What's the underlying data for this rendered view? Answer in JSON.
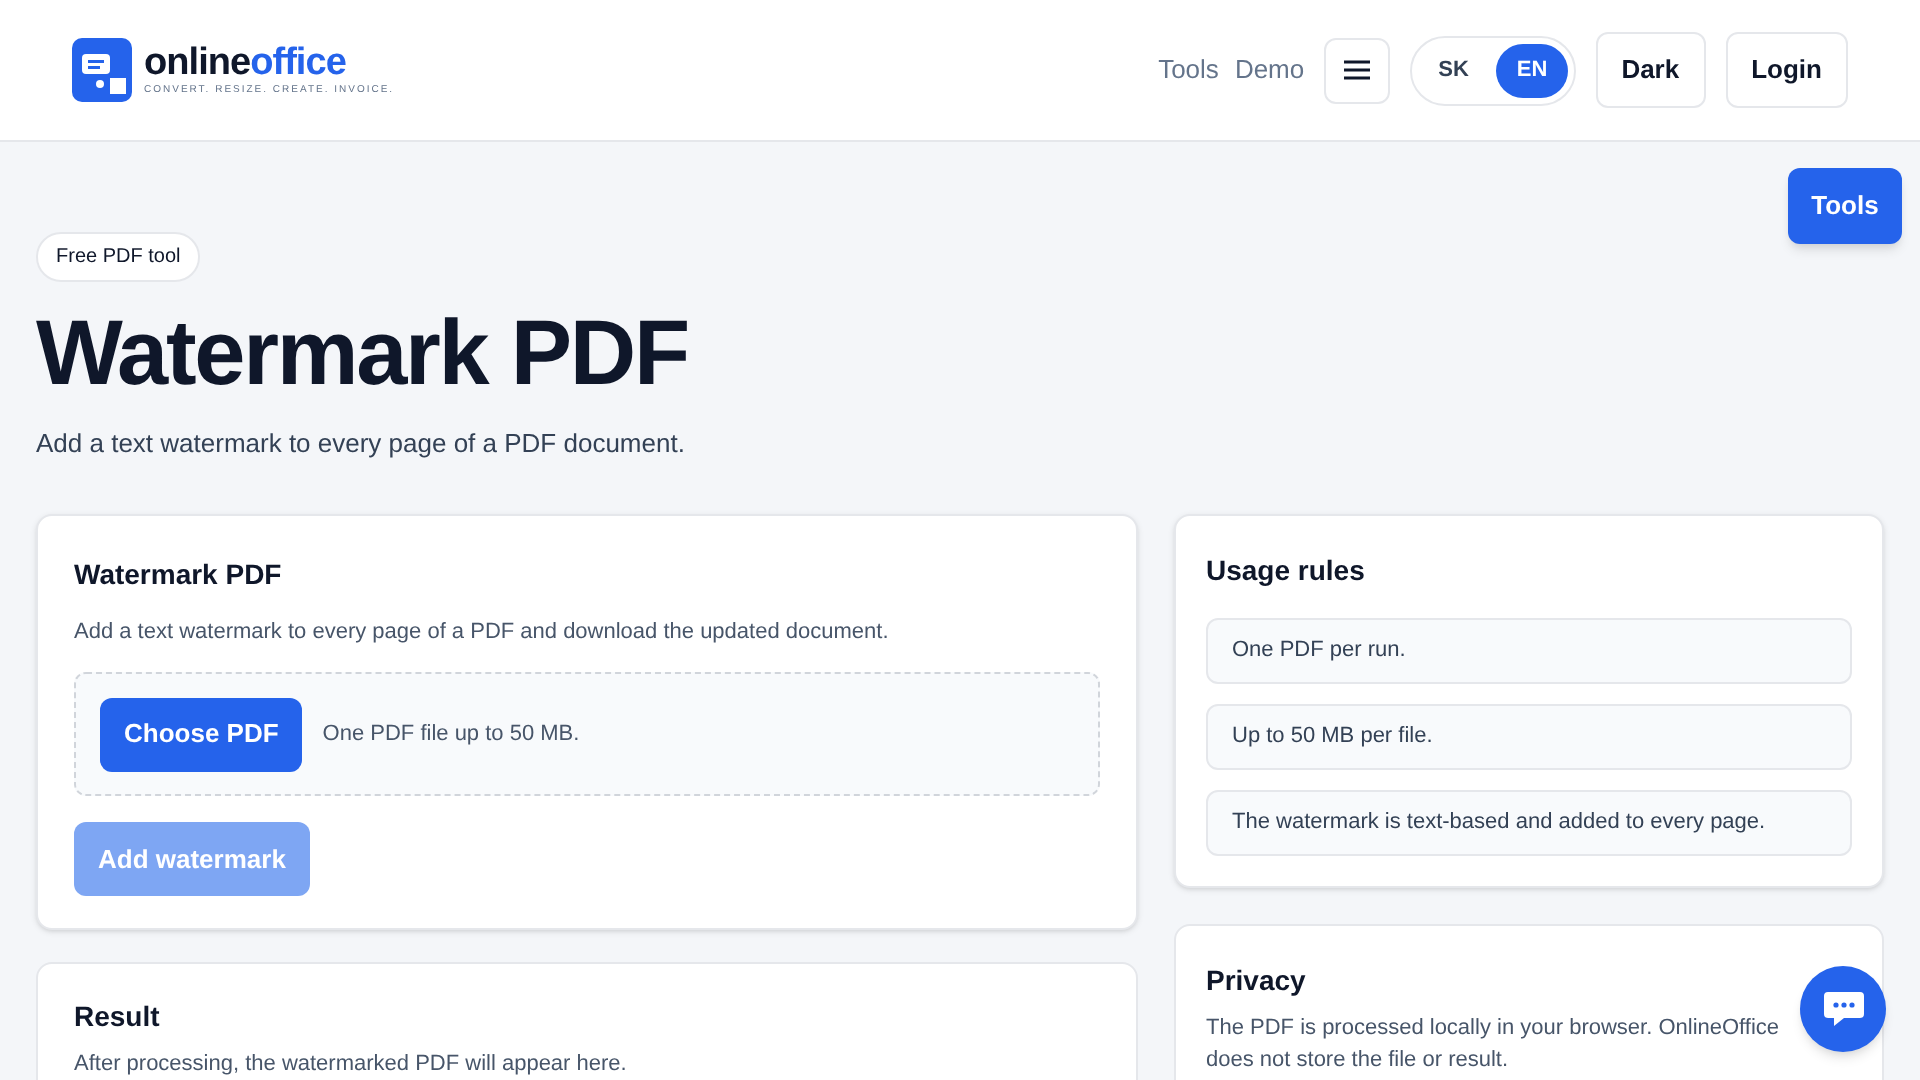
{
  "header": {
    "logo": {
      "name_dark": "online",
      "name_accent": "office",
      "tagline": "CONVERT. RESIZE. CREATE. INVOICE."
    },
    "nav": [
      "Tools",
      "Demo"
    ],
    "languages": [
      {
        "label": "SK",
        "selected": false
      },
      {
        "label": "EN",
        "selected": true
      }
    ],
    "buttons": [
      "Dark",
      "Login"
    ]
  },
  "floating_button": "Tools",
  "badge": "Free PDF tool",
  "title": "Watermark PDF",
  "subtitle": "Add a text watermark to every page of a PDF document.",
  "tool_card": {
    "title": "Watermark PDF",
    "description": "Add a text watermark to every page of a PDF and download the updated document.",
    "choose_button": "Choose PDF",
    "file_hint": "One PDF file up to 50 MB.",
    "action_button": {
      "label": "Add watermark",
      "disabled": true
    }
  },
  "result_card": {
    "title": "Result",
    "text": "After processing, the watermarked PDF will appear here."
  },
  "usage_rules": {
    "title": "Usage rules",
    "items": [
      "One PDF per run.",
      "Up to 50 MB per file.",
      "The watermark is text-based and added to every page."
    ]
  },
  "privacy": {
    "title": "Privacy",
    "text": "The PDF is processed locally in your browser. OnlineOffice does not store the file or result."
  }
}
